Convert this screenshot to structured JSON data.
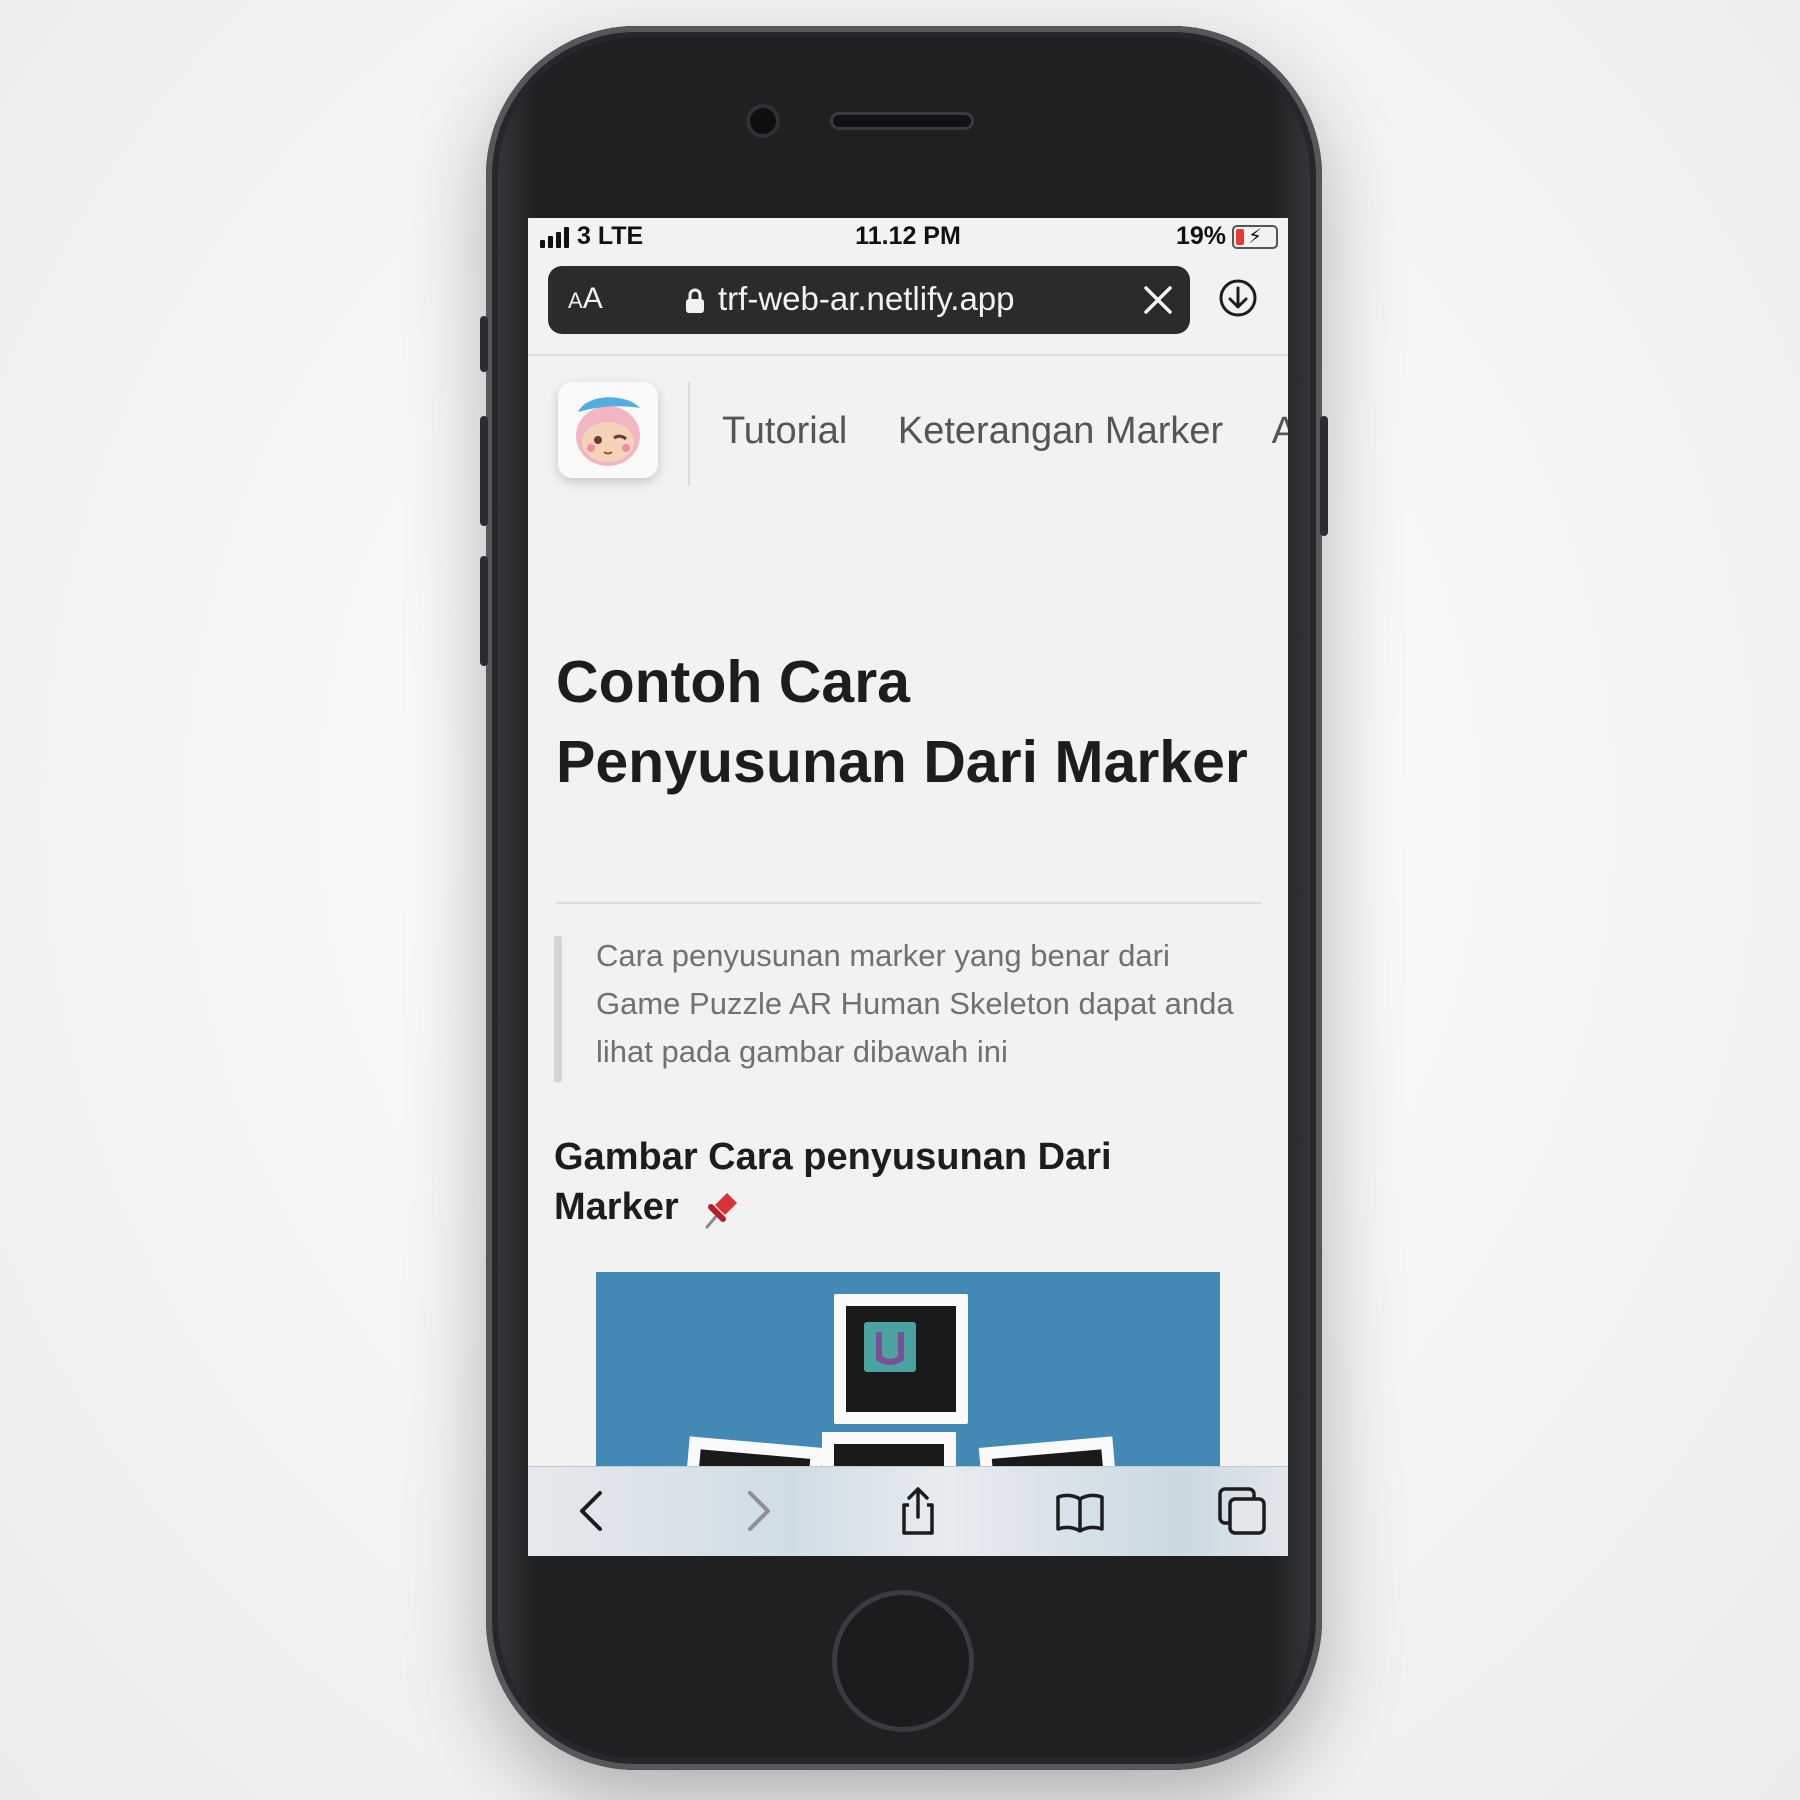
{
  "status_bar": {
    "carrier": "3 LTE",
    "time": "11.12 PM",
    "battery": "19%"
  },
  "browser": {
    "text_size_label_small": "A",
    "text_size_label_large": "A",
    "url": "trf-web-ar.netlify.app"
  },
  "site_nav": {
    "items": [
      {
        "label": "Tutorial"
      },
      {
        "label": "Keterangan Marker"
      },
      {
        "label": "A"
      }
    ]
  },
  "content": {
    "title": "Contoh Cara Penyusunan Dari Marker",
    "quote": "Cara penyusunan marker yang benar dari Game Puzzle AR Human Skeleton dapat anda lihat pada gambar dibawah ini",
    "subtitle": "Gambar Cara penyusunan Dari Marker"
  },
  "icons": {
    "lock": "lock-icon",
    "close": "close-icon",
    "download": "download-icon",
    "back": "back-chevron-icon",
    "forward": "forward-chevron-icon",
    "share": "share-icon",
    "bookmarks": "book-icon",
    "tabs": "tabs-icon",
    "pin": "pushpin-icon"
  },
  "colors": {
    "figure_bg": "#4389b6",
    "battery_low": "#e53935"
  }
}
